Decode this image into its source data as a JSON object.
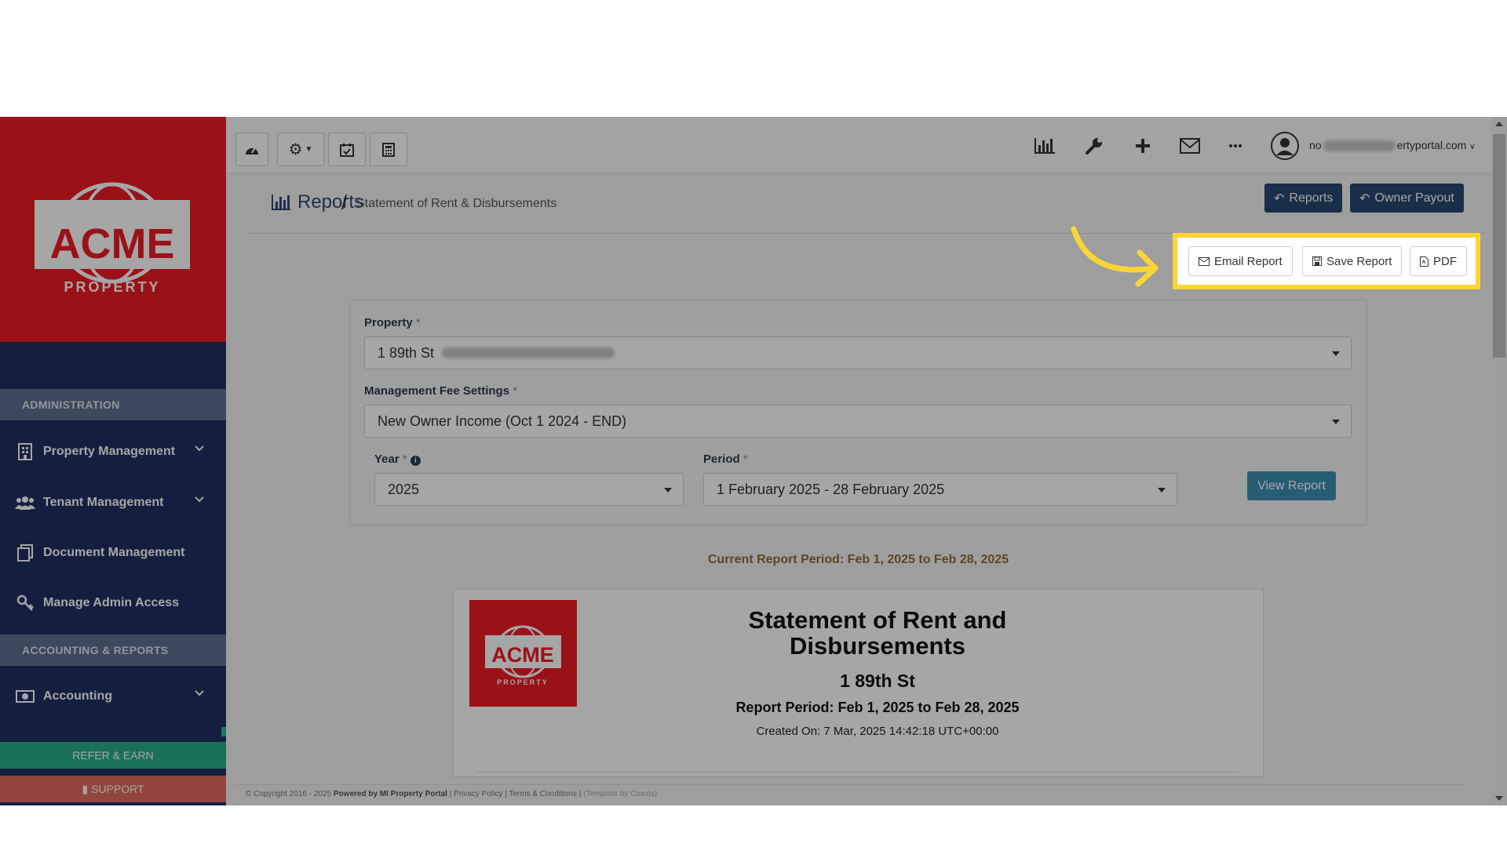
{
  "sidebar": {
    "brand_word": "ACME",
    "brand_sub": "PROPERTY",
    "section_admin": "ADMINISTRATION",
    "section_accounting": "ACCOUNTING & REPORTS",
    "items": [
      {
        "label": "Property Management",
        "icon": "building-icon"
      },
      {
        "label": "Tenant Management",
        "icon": "users-icon"
      },
      {
        "label": "Document Management",
        "icon": "documents-icon"
      },
      {
        "label": "Manage Admin Access",
        "icon": "key-icon"
      },
      {
        "label": "Accounting",
        "icon": "money-icon"
      }
    ],
    "refer_label": "REFER & EARN",
    "support_label": "SUPPORT"
  },
  "topbar": {
    "user_email_prefix": "no",
    "user_email_suffix": "ertyportal.com"
  },
  "breadcrumb": {
    "title": "Reports",
    "separator": "/",
    "current": "Statement of Rent & Disbursements"
  },
  "header_buttons": {
    "reports": "Reports",
    "owner_payout": "Owner Payout"
  },
  "actions": {
    "email": "Email Report",
    "save": "Save Report",
    "pdf": "PDF"
  },
  "form": {
    "property_label": "Property",
    "property_value": "1 89th St",
    "fee_label": "Management Fee Settings",
    "fee_value": "New Owner Income (Oct 1 2024 - END)",
    "year_label": "Year",
    "year_value": "2025",
    "period_label": "Period",
    "period_value": "1 February 2025 - 28 February 2025",
    "required_mark": "*",
    "view_button": "View Report"
  },
  "current_period": "Current Report Period: Feb 1, 2025 to Feb 28, 2025",
  "report": {
    "title": "Statement of Rent and Disbursements",
    "property": "1 89th St",
    "period": "Report Period: Feb 1, 2025 to Feb 28, 2025",
    "created": "Created On: 7 Mar, 2025 14:42:18 UTC+00:00"
  },
  "footer": {
    "copyright": "© Copyright 2016 - 2025",
    "powered": "Powered by MI Property Portal",
    "links": "| Privacy Policy | Terms & Conditions |",
    "template": "(Template by Coaxis)"
  },
  "colors": {
    "brand_red": "#ed1c24",
    "sidebar_navy": "#1f3163",
    "highlight_yellow": "#fcd535",
    "button_dark": "#27476f",
    "button_blue": "#3b8fb3"
  }
}
